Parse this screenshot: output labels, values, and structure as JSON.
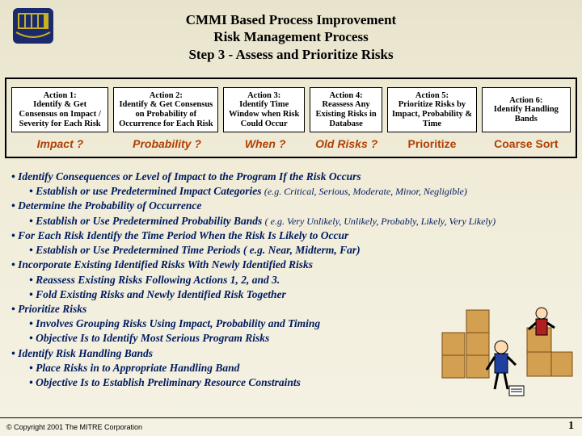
{
  "title": {
    "line1": "CMMI Based Process Improvement",
    "line2": "Risk Management Process",
    "line3": "Step 3 - Assess and Prioritize Risks"
  },
  "actions": [
    {
      "heading": "Action 1:",
      "body": "Identify & Get Consensus on Impact / Severity for Each Risk"
    },
    {
      "heading": "Action 2:",
      "body": "Identify & Get Consensus on Probability of Occurrence for Each Risk"
    },
    {
      "heading": "Action 3:",
      "body": "Identify Time Window when Risk Could Occur"
    },
    {
      "heading": "Action 4:",
      "body": "Reassess Any Existing Risks in Database"
    },
    {
      "heading": "Action 5:",
      "body": "Prioritize Risks by Impact, Probability & Time"
    },
    {
      "heading": "Action 6:",
      "body": "Identify Handling Bands"
    }
  ],
  "questions": {
    "q1": "Impact ?",
    "q2": "Probability ?",
    "q3": "When ?",
    "q4": "Old Risks ?",
    "q5": "Prioritize",
    "q6": "Coarse Sort"
  },
  "bullets": {
    "b1": "Identify Consequences or Level of Impact to the Program If the Risk Occurs",
    "b1a": "Establish or use Predetermined Impact Categories",
    "b1a_note": "(e.g. Critical, Serious, Moderate, Minor, Negligible)",
    "b2": "Determine the Probability of Occurrence",
    "b2a": "Establish or Use Predetermined Probability Bands",
    "b2a_note": "( e.g. Very Unlikely, Unlikely, Probably, Likely, Very Likely)",
    "b3": "For Each Risk Identify the Time Period When the Risk Is Likely to Occur",
    "b3a": "Establish or Use Predetermined Time Periods ( e.g. Near, Midterm, Far)",
    "b4": "Incorporate Existing Identified Risks With Newly Identified Risks",
    "b4a": "Reassess Existing Risks Following Actions 1, 2, and 3.",
    "b4b": "Fold Existing Risks and Newly Identified Risk Together",
    "b5": "Prioritize Risks",
    "b5a": "Involves Grouping Risks Using Impact, Probability and Timing",
    "b5b": "Objective Is to Identify Most Serious Program Risks",
    "b6": "Identify Risk Handling Bands",
    "b6a": "Place Risks in to Appropriate Handling Band",
    "b6b": "Objective Is to Establish Preliminary Resource Constraints"
  },
  "copyright": "© Copyright 2001 The MITRE Corporation",
  "page_number": "1"
}
